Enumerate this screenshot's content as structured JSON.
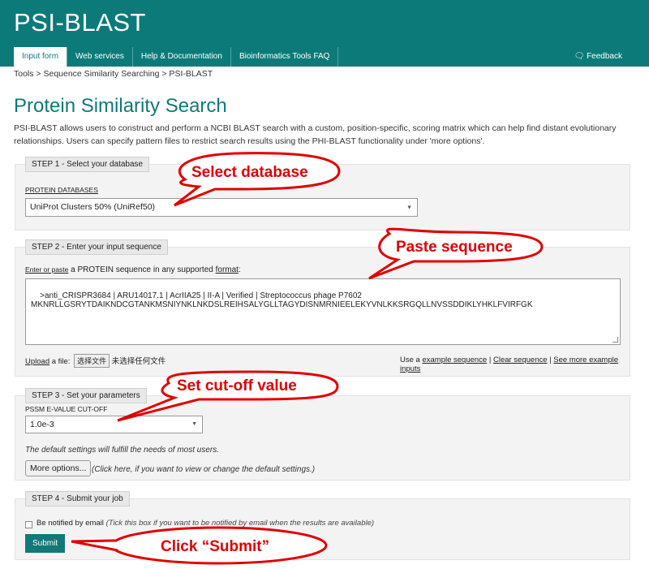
{
  "header": {
    "brand": "PSI-BLAST",
    "tabs": [
      {
        "label": "Input form"
      },
      {
        "label": "Web services"
      },
      {
        "label": "Help & Documentation"
      },
      {
        "label": "Bioinformatics Tools FAQ"
      }
    ],
    "feedback": "Feedback",
    "feedback_icon": "chat-bubbles-icon"
  },
  "breadcrumb": "Tools > Sequence Similarity Searching > PSI-BLAST",
  "page_title": "Protein Similarity Search",
  "intro": "PSI-BLAST allows users to construct and perform a NCBI BLAST search with a custom, position-specific, scoring matrix which can help find distant evolutionary relationships. Users can specify pattern files to restrict search results using the PHI-BLAST functionality under 'more options'.",
  "step1": {
    "legend": "STEP 1 - Select your database",
    "db_label": "PROTEIN DATABASES",
    "db_value": "UniProt Clusters 50% (UniRef50)"
  },
  "step2": {
    "legend": "STEP 2 - Enter your input sequence",
    "label_link": "Enter or paste",
    "label_mid": "a PROTEIN sequence in any supported",
    "label_format": "format",
    "label_colon": ":",
    "sequence": ">anti_CRISPR3684 | ARU14017.1 | AcrIIA25 | II-A | Verified | Streptococcus phage P7602\nMKNRLLGSRYTDAIKNDCGTANKMSNIYNKLNKDSLREIHSALYGLLTAGYDISNMRNIEELEKYVNLKKSRGQLLNVSSDDIKLYHKLFVIRFGK",
    "upload_link": "Upload",
    "upload_text": "a file:",
    "choose_file": "选择文件",
    "no_file": "未选择任何文件",
    "use_a": "Use a",
    "example_seq": "example sequence",
    "clear_seq": "Clear sequence",
    "more_examples": "See more example inputs"
  },
  "step3": {
    "legend": "STEP 3 - Set your parameters",
    "evalue_label": "PSSM E-VALUE CUT-OFF",
    "evalue_value": "1.0e-3",
    "default_note": "The default settings will fulfill the needs of most users.",
    "more_options": "More options...",
    "more_note": "(Click here, if you want to view or change the default settings.)"
  },
  "step4": {
    "legend": "STEP 4 - Submit your job",
    "notify_label": "Be notified by email",
    "notify_note": "(Tick this box if you want to be notified by email when the results are available)",
    "submit": "Submit"
  },
  "callouts": {
    "select_db": "Select database",
    "paste_seq": "Paste sequence",
    "set_cutoff": "Set cut-off value",
    "click_submit": "Click “Submit”"
  },
  "colors": {
    "brand_teal": "#0d7a7a",
    "callout_red": "#e00000"
  }
}
